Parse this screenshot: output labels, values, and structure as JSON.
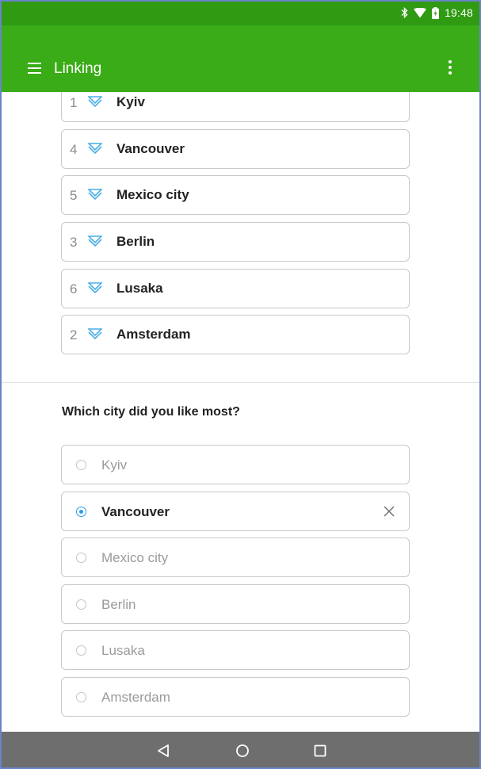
{
  "status_bar": {
    "time": "19:48",
    "icons": [
      "bluetooth-icon",
      "wifi-icon",
      "battery-icon"
    ]
  },
  "app_bar": {
    "title": "Linking",
    "icons": [
      "menu-icon",
      "overflow-menu-icon"
    ],
    "color": "#3aac17"
  },
  "ranking": {
    "items": [
      {
        "number": "1",
        "label": "Kyiv"
      },
      {
        "number": "4",
        "label": "Vancouver"
      },
      {
        "number": "5",
        "label": "Mexico city"
      },
      {
        "number": "3",
        "label": "Berlin"
      },
      {
        "number": "6",
        "label": "Lusaka"
      },
      {
        "number": "2",
        "label": "Amsterdam"
      }
    ],
    "item_icon": "reorder-icon"
  },
  "question": {
    "text": "Which city did you like most?",
    "options": [
      {
        "label": "Kyiv",
        "selected": false
      },
      {
        "label": "Vancouver",
        "selected": true
      },
      {
        "label": "Mexico city",
        "selected": false
      },
      {
        "label": "Berlin",
        "selected": false
      },
      {
        "label": "Lusaka",
        "selected": false
      },
      {
        "label": "Amsterdam",
        "selected": false
      }
    ],
    "accent": "#2c9be8"
  },
  "nav_bar": {
    "icons": [
      "back-icon",
      "home-icon",
      "recents-icon"
    ]
  }
}
